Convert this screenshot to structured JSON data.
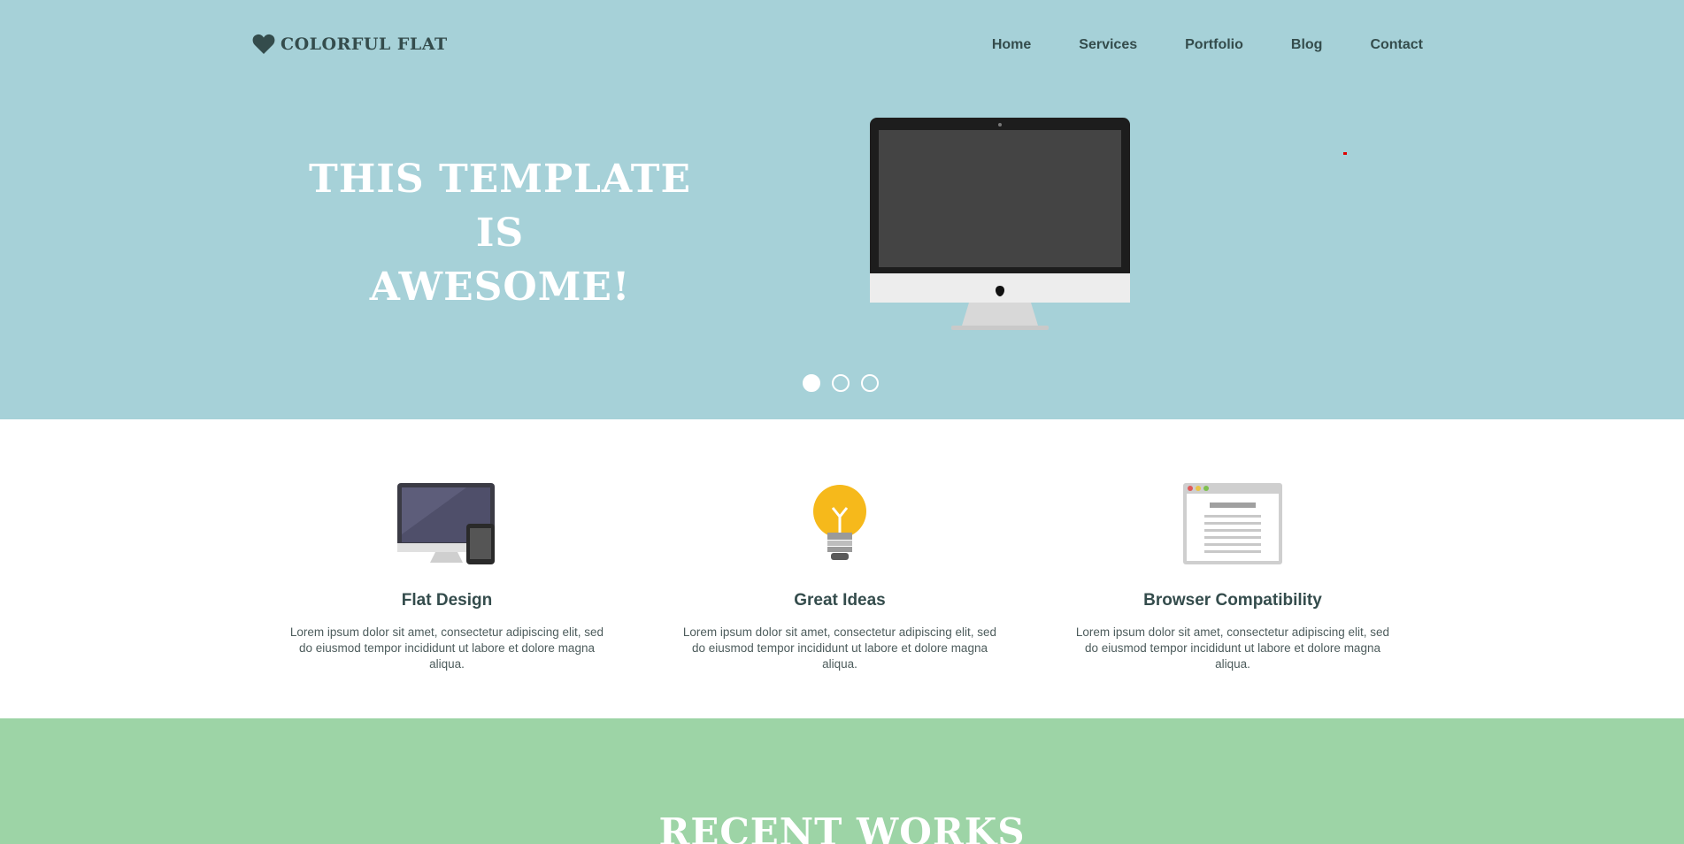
{
  "brand": {
    "name": "COLORFUL FLAT",
    "icon": "heart-icon"
  },
  "nav": {
    "items": [
      "Home",
      "Services",
      "Portfolio",
      "Blog",
      "Contact"
    ]
  },
  "hero": {
    "title_line1": "THIS TEMPLATE IS",
    "title_line2": "AWESOME!",
    "image": "imac-icon",
    "slides": 3,
    "active_slide": 1
  },
  "features": [
    {
      "icon": "devices-icon",
      "title": "Flat Design",
      "text": "Lorem ipsum dolor sit amet, consectetur adipiscing elit, sed do eiusmod tempor incididunt ut labore et dolore magna aliqua."
    },
    {
      "icon": "lightbulb-icon",
      "title": "Great Ideas",
      "text": "Lorem ipsum dolor sit amet, consectetur adipiscing elit, sed do eiusmod tempor incididunt ut labore et dolore magna aliqua."
    },
    {
      "icon": "browser-window-icon",
      "title": "Browser Compatibility",
      "text": "Lorem ipsum dolor sit amet, consectetur adipiscing elit, sed do eiusmod tempor incididunt ut labore et dolore magna aliqua."
    }
  ],
  "works": {
    "title": "RECENT WORKS"
  },
  "colors": {
    "hero_bg": "#a6d1d8",
    "works_bg": "#9dd4a6",
    "text_dark": "#344c4c",
    "white": "#ffffff"
  }
}
